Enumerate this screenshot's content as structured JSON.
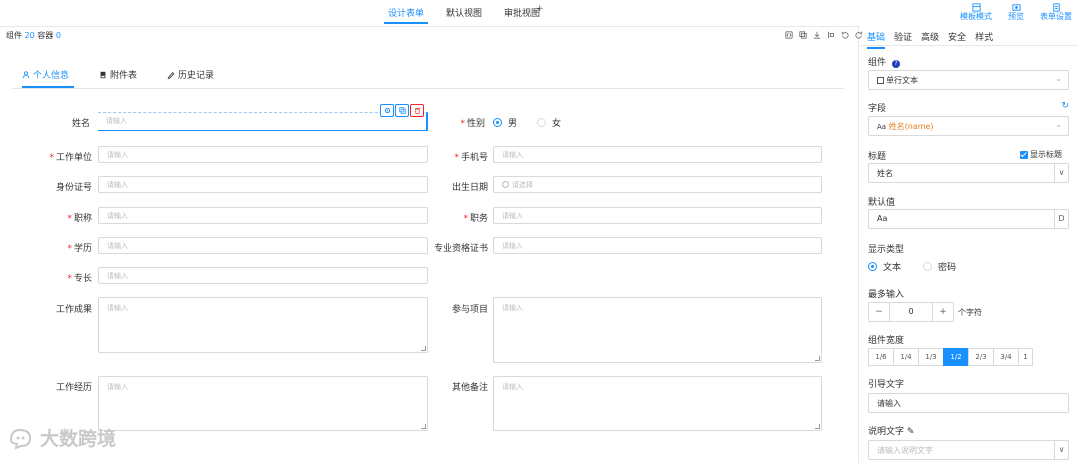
{
  "view_tabs": [
    {
      "label": "设计表单",
      "active": true
    },
    {
      "label": "默认视图",
      "active": false
    },
    {
      "label": "审批视图",
      "active": false
    }
  ],
  "view_tabs_more": "+",
  "top_actions": [
    {
      "label": "模板模式",
      "icon": "template-icon"
    },
    {
      "label": "预览",
      "icon": "preview-icon"
    },
    {
      "label": "表单设置",
      "icon": "settings-icon"
    }
  ],
  "canvas_meta": {
    "components_label": "组件",
    "components_count": "20",
    "container_label": "容器",
    "container_count": "0"
  },
  "form_tabs": [
    {
      "label": "个人信息",
      "icon": "person-icon",
      "active": true
    },
    {
      "label": "附件表",
      "icon": "attachment-icon",
      "active": false
    },
    {
      "label": "历史记录",
      "icon": "history-icon",
      "active": false
    }
  ],
  "form": {
    "placeholder": "请输入",
    "date_placeholder": "请选择",
    "fields": {
      "name": "姓名",
      "gender": "性别",
      "work_unit": "工作单位",
      "phone": "手机号",
      "id_number": "身份证号",
      "birth_date": "出生日期",
      "title": "职称",
      "position": "职务",
      "education": "学历",
      "professional_cert": "专业资格证书",
      "specialty": "专长",
      "achievements": "工作成果",
      "projects": "参与项目",
      "work_history": "工作经历",
      "other_notes": "其他备注"
    },
    "gender_options": [
      {
        "label": "男",
        "checked": true
      },
      {
        "label": "女",
        "checked": false
      }
    ]
  },
  "panel": {
    "tabs": [
      {
        "label": "基础",
        "active": true
      },
      {
        "label": "验证",
        "active": false
      },
      {
        "label": "高级",
        "active": false
      },
      {
        "label": "安全",
        "active": false
      },
      {
        "label": "样式",
        "active": false
      }
    ],
    "component_label": "组件",
    "component_value": "单行文本",
    "field_label": "字段",
    "field_value_prefix": "Aa",
    "field_value": "姓名(name)",
    "title_label": "标题",
    "show_title_label": "显示标题",
    "title_value": "姓名",
    "default_label": "默认值",
    "default_value": "Aa",
    "display_type_label": "显示类型",
    "display_types": [
      {
        "label": "文本",
        "checked": true
      },
      {
        "label": "密码",
        "checked": false
      }
    ],
    "max_input_label": "最多输入",
    "max_input_value": "0",
    "max_input_unit": "个字符",
    "width_label": "组件宽度",
    "width_options": [
      {
        "label": "1/6",
        "on": false
      },
      {
        "label": "1/4",
        "on": false
      },
      {
        "label": "1/3",
        "on": false
      },
      {
        "label": "1/2",
        "on": true
      },
      {
        "label": "2/3",
        "on": false
      },
      {
        "label": "3/4",
        "on": false
      },
      {
        "label": "1",
        "on": false
      }
    ],
    "guide_label": "引导文字",
    "guide_value": "请输入",
    "desc_label": "说明文字",
    "desc_placeholder": "请输入说明文字"
  },
  "watermark": "大数跨境",
  "colors": {
    "accent": "#1890ff",
    "required": "#f5222d"
  }
}
